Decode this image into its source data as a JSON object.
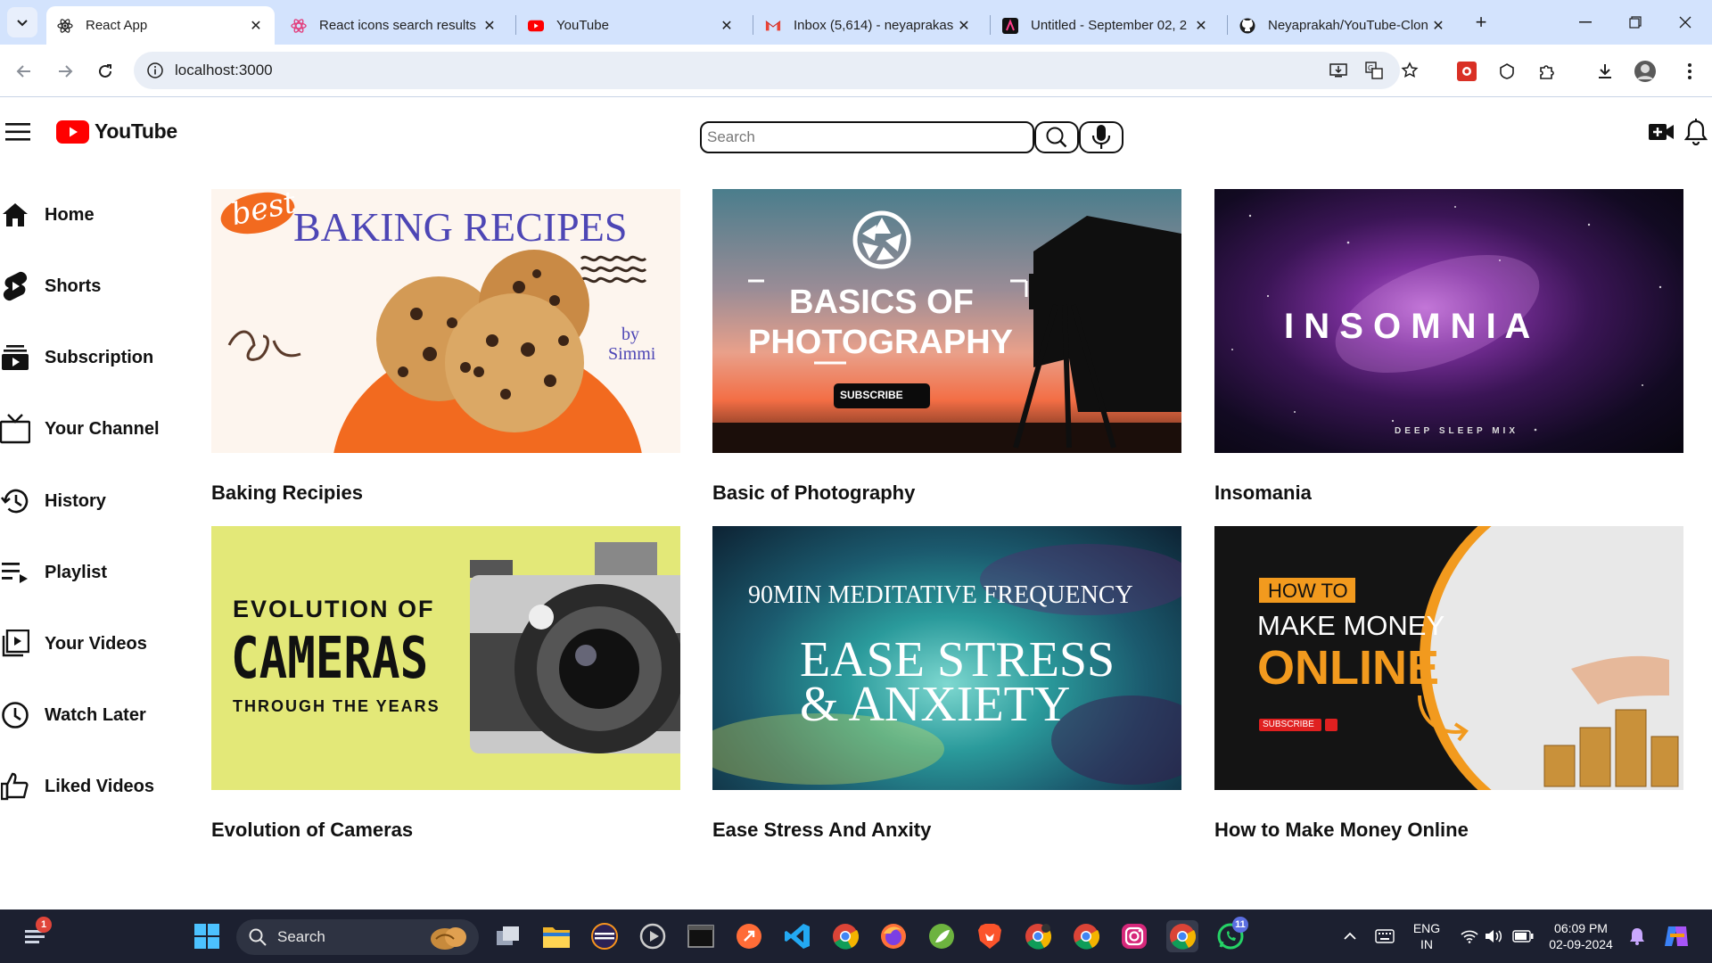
{
  "browser": {
    "tabs": [
      {
        "title": "React App",
        "active": true,
        "icon": "react-icon"
      },
      {
        "title": "React icons search results",
        "active": false,
        "icon": "react-icons-icon"
      },
      {
        "title": "YouTube",
        "active": false,
        "icon": "youtube-icon"
      },
      {
        "title": "Inbox (5,614) - neyaprakas",
        "active": false,
        "icon": "gmail-icon"
      },
      {
        "title": "Untitled - September 02, 2",
        "active": false,
        "icon": "canva-icon"
      },
      {
        "title": "Neyaprakah/YouTube-Clon",
        "active": false,
        "icon": "github-icon"
      }
    ],
    "url": "localhost:3000"
  },
  "app": {
    "brand": "YouTube",
    "search_placeholder": "Search",
    "sidebar": [
      {
        "label": "Home",
        "icon": "home-icon"
      },
      {
        "label": "Shorts",
        "icon": "shorts-icon"
      },
      {
        "label": "Subscription",
        "icon": "subscription-icon"
      },
      {
        "label": "Your Channel",
        "icon": "channel-icon"
      },
      {
        "label": "History",
        "icon": "history-icon"
      },
      {
        "label": "Playlist",
        "icon": "playlist-icon"
      },
      {
        "label": "Your Videos",
        "icon": "your-videos-icon"
      },
      {
        "label": "Watch Later",
        "icon": "watch-later-icon"
      },
      {
        "label": "Liked Videos",
        "icon": "liked-icon"
      }
    ],
    "videos": [
      {
        "title": "Baking Recipies",
        "thumb": {
          "badge": "best",
          "heading": "BAKING RECIPES",
          "byline_1": "by",
          "byline_2": "Simmi"
        }
      },
      {
        "title": "Basic of Photography",
        "thumb": {
          "line_1": "BASICS OF",
          "line_2": "PHOTOGRAPHY",
          "button": "SUBSCRIBE"
        }
      },
      {
        "title": "Insomania",
        "thumb": {
          "heading": "I N S O M N I A",
          "sub": "DEEP SLEEP MIX"
        }
      },
      {
        "title": "Evolution of Cameras",
        "thumb": {
          "line_1": "EVOLUTION OF",
          "line_2": "CAMERAS",
          "line_3": "THROUGH THE YEARS"
        }
      },
      {
        "title": "Ease Stress And Anxity",
        "thumb": {
          "line_1": "90MIN MEDITATIVE FREQUENCY",
          "line_2": "EASE STRESS",
          "line_3": "& ANXIETY"
        }
      },
      {
        "title": "How to Make Money Online",
        "thumb": {
          "tag": "HOW TO",
          "line_1": "MAKE MONEY",
          "line_2": "ONLINE",
          "button": "SUBSCRIBE"
        }
      }
    ]
  },
  "taskbar": {
    "search_label": "Search",
    "lang_1": "ENG",
    "lang_2": "IN",
    "time": "06:09 PM",
    "date": "02-09-2024",
    "notify_badge": "1",
    "whatsapp_badge": "11"
  },
  "colors": {
    "tabbar": "#d3e3fd",
    "youtube_red": "#ff0000",
    "taskbar": "#1c2030"
  }
}
